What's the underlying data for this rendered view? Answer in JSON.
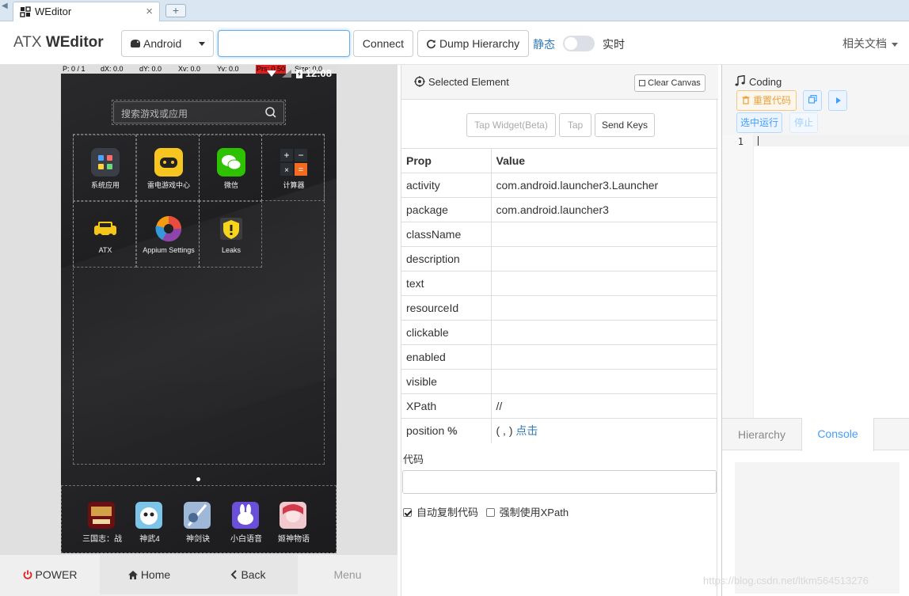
{
  "browser": {
    "tab_title": "WEditor",
    "close_glyph": "×",
    "new_tab_glyph": "+"
  },
  "header": {
    "brand_prefix": "ATX ",
    "brand_name": "WEditor",
    "platform": "Android",
    "serial_value": "",
    "connect_label": "Connect",
    "dump_label": "Dump Hierarchy",
    "mode_static": "静态",
    "mode_live": "实时",
    "docs_label": "相关文档"
  },
  "device": {
    "coords": {
      "p": "P: 0 / 1",
      "dx": "dX: 0.0",
      "dy": "dY: 0.0",
      "xv": "Xv: 0.0",
      "yv": "Yv: 0.0",
      "prs": "Prs: 0.50",
      "size": "Size: 0.0"
    },
    "clock": "12:08",
    "search_placeholder": "搜索游戏或应用",
    "apps": [
      {
        "label": "系统应用",
        "icon": "system-apps-icon"
      },
      {
        "label": "雷电游戏中心",
        "icon": "game-center-icon"
      },
      {
        "label": "微信",
        "icon": "wechat-icon"
      },
      {
        "label": "计算器",
        "icon": "calculator-icon"
      },
      {
        "label": "ATX",
        "icon": "atx-icon"
      },
      {
        "label": "Appium Settings",
        "icon": "appium-icon"
      },
      {
        "label": "Leaks",
        "icon": "leaks-icon"
      }
    ],
    "dock": [
      {
        "label": "三国志：战",
        "icon": "sanguozhi-icon"
      },
      {
        "label": "神武4",
        "icon": "shenwu-icon"
      },
      {
        "label": "神剑诀",
        "icon": "shenjianjue-icon"
      },
      {
        "label": "小白语音",
        "icon": "xiaobai-icon"
      },
      {
        "label": "姬神物语",
        "icon": "jishen-icon"
      }
    ],
    "nav": {
      "power": "POWER",
      "home": "Home",
      "back": "Back",
      "menu": "Menu"
    }
  },
  "inspector": {
    "title": "Selected Element",
    "clear_canvas": "Clear Canvas",
    "tap_widget": "Tap Widget(Beta)",
    "tap": "Tap",
    "send_keys": "Send Keys",
    "col_prop": "Prop",
    "col_value": "Value",
    "rows": [
      {
        "prop": "activity",
        "value": "com.android.launcher3.Launcher"
      },
      {
        "prop": "package",
        "value": "com.android.launcher3"
      },
      {
        "prop": "className",
        "value": ""
      },
      {
        "prop": "description",
        "value": ""
      },
      {
        "prop": "text",
        "value": ""
      },
      {
        "prop": "resourceId",
        "value": ""
      },
      {
        "prop": "clickable",
        "value": ""
      },
      {
        "prop": "enabled",
        "value": ""
      },
      {
        "prop": "visible",
        "value": ""
      },
      {
        "prop": "XPath",
        "value": "//"
      }
    ],
    "position_prop": "position",
    "position_unit": "%",
    "position_value": "( , )",
    "position_link": "点击",
    "code_label": "代码",
    "code_value": "",
    "auto_copy": "自动复制代码",
    "force_xpath": "强制使用XPath",
    "auto_copy_checked": true,
    "force_xpath_checked": false
  },
  "coding": {
    "title": "Coding",
    "reset": "重置代码",
    "run_selected": "选中运行",
    "stop": "停止",
    "line_no": "1",
    "tab_hierarchy": "Hierarchy",
    "tab_console": "Console",
    "active_tab": "Console"
  },
  "watermark": "https://blog.csdn.net/ltkm564513276",
  "colors": {
    "accent": "#409eff",
    "warning": "#e6a23c",
    "link": "#337ab7",
    "power_red": "#e02020"
  }
}
